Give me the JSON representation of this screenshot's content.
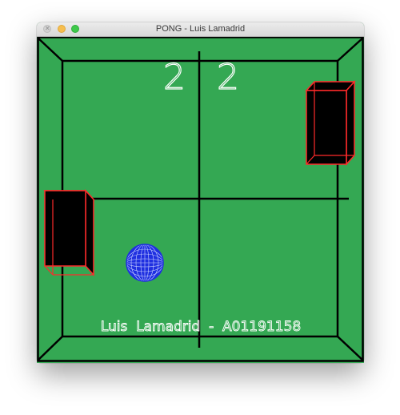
{
  "window": {
    "title": "PONG - Luis Lamadrid"
  },
  "game": {
    "score_left": "2",
    "score_right": "2",
    "credit": "Luis  Lamadrid  -  A01191158",
    "colors": {
      "background": "#34a853",
      "lines": "#000000",
      "paddle_fill": "#000000",
      "paddle_edges": "#ff2a2a",
      "ball": "#1f2fe0",
      "text": "#ffffff"
    }
  }
}
